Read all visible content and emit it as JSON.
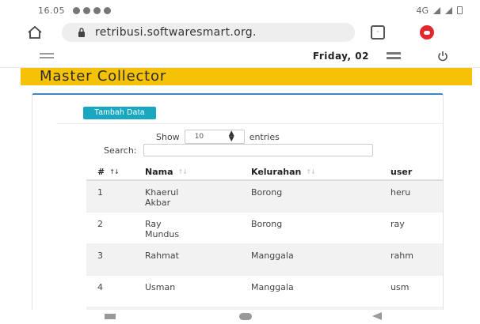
{
  "statusbar": {
    "time": "16.05",
    "network": "4G"
  },
  "browser": {
    "url": "retribusi.softwaresmart.org."
  },
  "header": {
    "date": "Friday, 02"
  },
  "page": {
    "title": "Master Collector"
  },
  "toolbar": {
    "add_label": "Tambah Data",
    "show_label": "Show",
    "entries_value": "10",
    "entries_label": "entries",
    "search_label": "Search:",
    "search_value": ""
  },
  "table": {
    "columns": [
      "#",
      "Nama",
      "Kelurahan",
      "user"
    ],
    "rows": [
      {
        "no": "1",
        "nama_line1": "Khaerul",
        "nama_line2": "Akbar",
        "kelurahan": "Borong",
        "user": "heru"
      },
      {
        "no": "2",
        "nama_line1": "Ray",
        "nama_line2": "Mundus",
        "kelurahan": "Borong",
        "user": "ray"
      },
      {
        "no": "3",
        "nama_line1": "Rahmat",
        "nama_line2": "",
        "kelurahan": "Manggala",
        "user": "rahm"
      },
      {
        "no": "4",
        "nama_line1": "Usman",
        "nama_line2": "",
        "kelurahan": "Manggala",
        "user": "usm"
      }
    ]
  },
  "colors": {
    "accent": "#f5c206",
    "button": "#1aa8c0",
    "card_border": "#3a86c8"
  }
}
